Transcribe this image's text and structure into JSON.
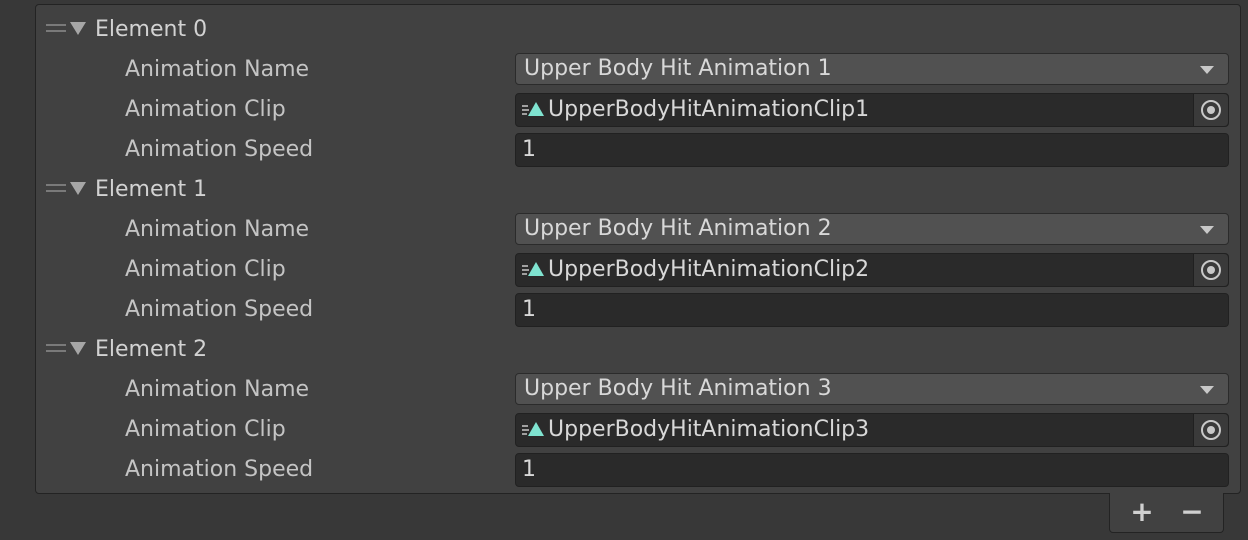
{
  "elements": [
    {
      "title": "Element 0",
      "name_label": "Animation Name",
      "name_value": "Upper Body Hit Animation 1",
      "clip_label": "Animation Clip",
      "clip_value": "UpperBodyHitAnimationClip1",
      "speed_label": "Animation Speed",
      "speed_value": "1"
    },
    {
      "title": "Element 1",
      "name_label": "Animation Name",
      "name_value": "Upper Body Hit Animation 2",
      "clip_label": "Animation Clip",
      "clip_value": "UpperBodyHitAnimationClip2",
      "speed_label": "Animation Speed",
      "speed_value": "1"
    },
    {
      "title": "Element 2",
      "name_label": "Animation Name",
      "name_value": "Upper Body Hit Animation 3",
      "clip_label": "Animation Clip",
      "clip_value": "UpperBodyHitAnimationClip3",
      "speed_label": "Animation Speed",
      "speed_value": "1"
    }
  ],
  "footer": {
    "add_label": "+",
    "remove_label": "−"
  },
  "icons": {
    "drag_handle": "drag-handle-icon",
    "foldout": "foldout-arrow-icon",
    "dropdown": "chevron-down-icon",
    "clip": "animation-clip-icon",
    "picker": "object-picker-icon"
  },
  "colors": {
    "panel_bg": "#414141",
    "field_bg": "#2a2a2a",
    "dropdown_bg": "#515151",
    "clip_icon_accent": "#7fe3d0"
  }
}
